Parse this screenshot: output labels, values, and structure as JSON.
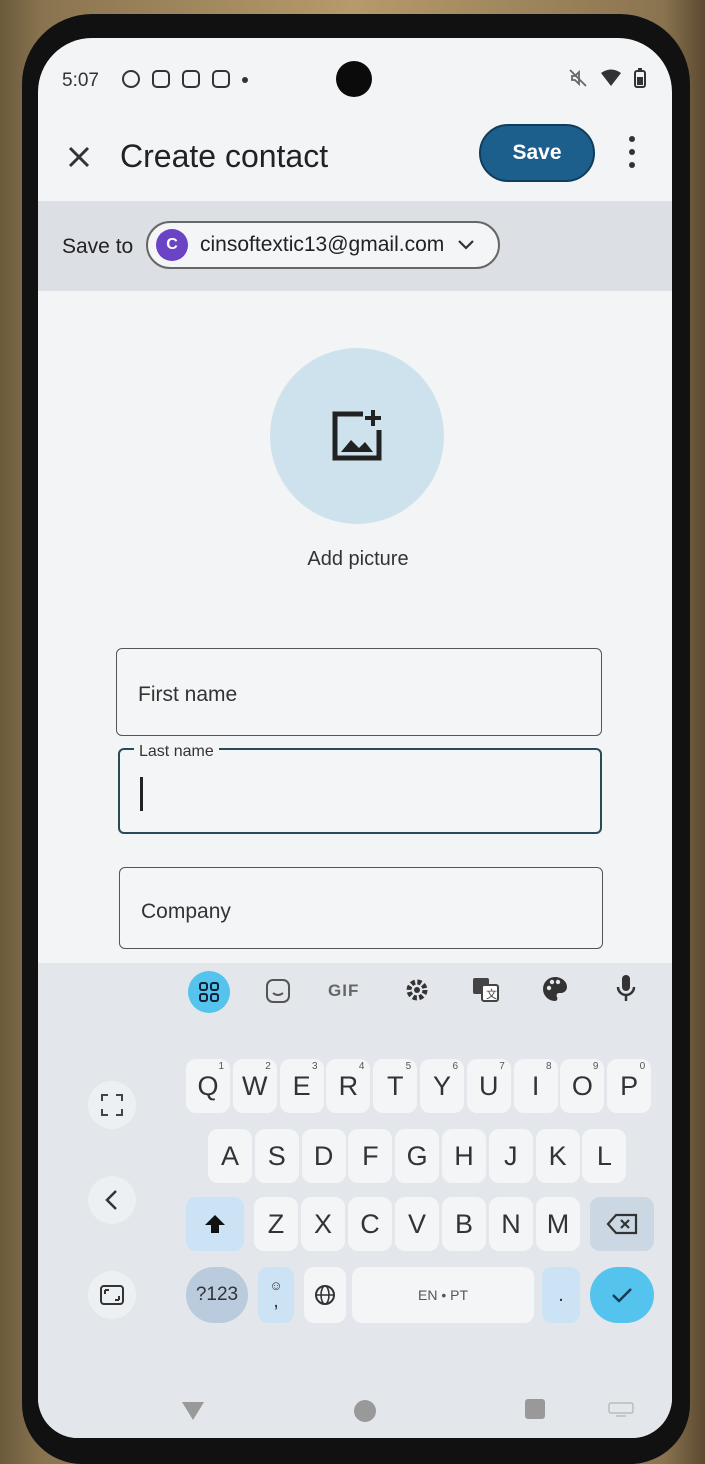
{
  "status_bar": {
    "time": "5:07"
  },
  "header": {
    "close_icon": "close-icon",
    "title": "Create contact",
    "save_label": "Save",
    "more_icon": "more-vert-icon"
  },
  "save_to": {
    "label": "Save to",
    "account_initial": "C",
    "account_email": "cinsoftextic13@gmail.com",
    "avatar_color": "#6a44c4"
  },
  "picture": {
    "label": "Add picture"
  },
  "form": {
    "first_name_placeholder": "First name",
    "last_name_label": "Last name",
    "last_name_value": "",
    "company_placeholder": "Company"
  },
  "keyboard": {
    "toolbar": [
      "apps-grid-icon",
      "sticker-icon",
      "gif-icon",
      "settings-icon",
      "translate-icon",
      "palette-icon",
      "mic-icon"
    ],
    "toolbar_gif": "GIF",
    "row1": [
      {
        "k": "Q",
        "h": "1"
      },
      {
        "k": "W",
        "h": "2"
      },
      {
        "k": "E",
        "h": "3"
      },
      {
        "k": "R",
        "h": "4"
      },
      {
        "k": "T",
        "h": "5"
      },
      {
        "k": "Y",
        "h": "6"
      },
      {
        "k": "U",
        "h": "7"
      },
      {
        "k": "I",
        "h": "8"
      },
      {
        "k": "O",
        "h": "9"
      },
      {
        "k": "P",
        "h": "0"
      }
    ],
    "row2": [
      "A",
      "S",
      "D",
      "F",
      "G",
      "H",
      "J",
      "K",
      "L"
    ],
    "row3": [
      "Z",
      "X",
      "C",
      "V",
      "B",
      "N",
      "M"
    ],
    "symbols_label": "?123",
    "emoji_comma": ",",
    "space_label": "EN • PT",
    "period_label": ".",
    "accent_color": "#54c3ee"
  }
}
